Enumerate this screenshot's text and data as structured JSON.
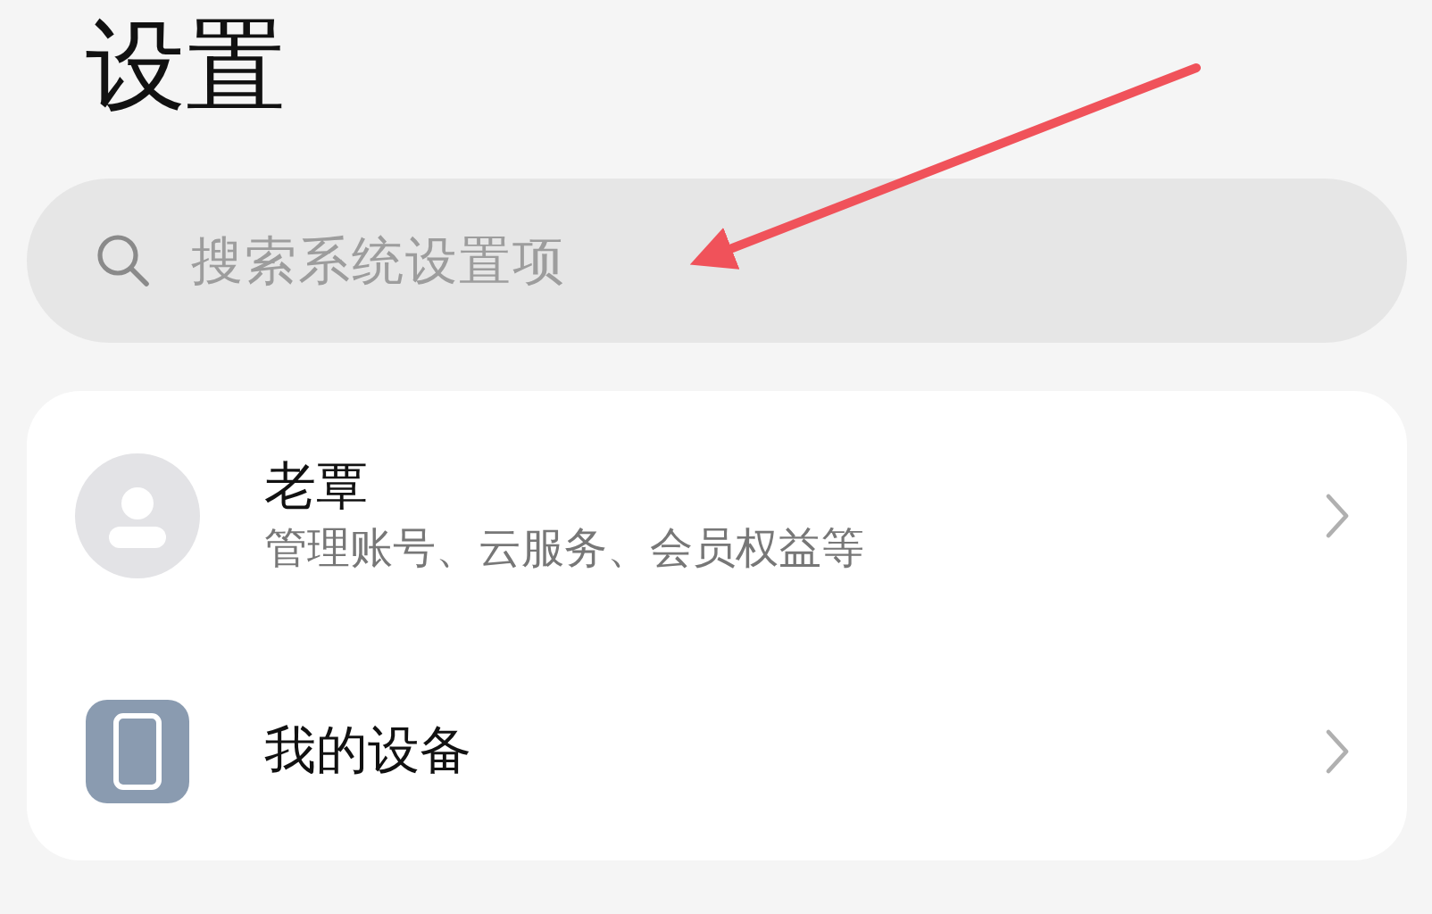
{
  "title": "设置",
  "search": {
    "placeholder": "搜索系统设置项"
  },
  "items": [
    {
      "kind": "account",
      "label": "老覃",
      "subtitle": "管理账号、云服务、会员权益等"
    },
    {
      "kind": "device",
      "label": "我的设备"
    }
  ]
}
